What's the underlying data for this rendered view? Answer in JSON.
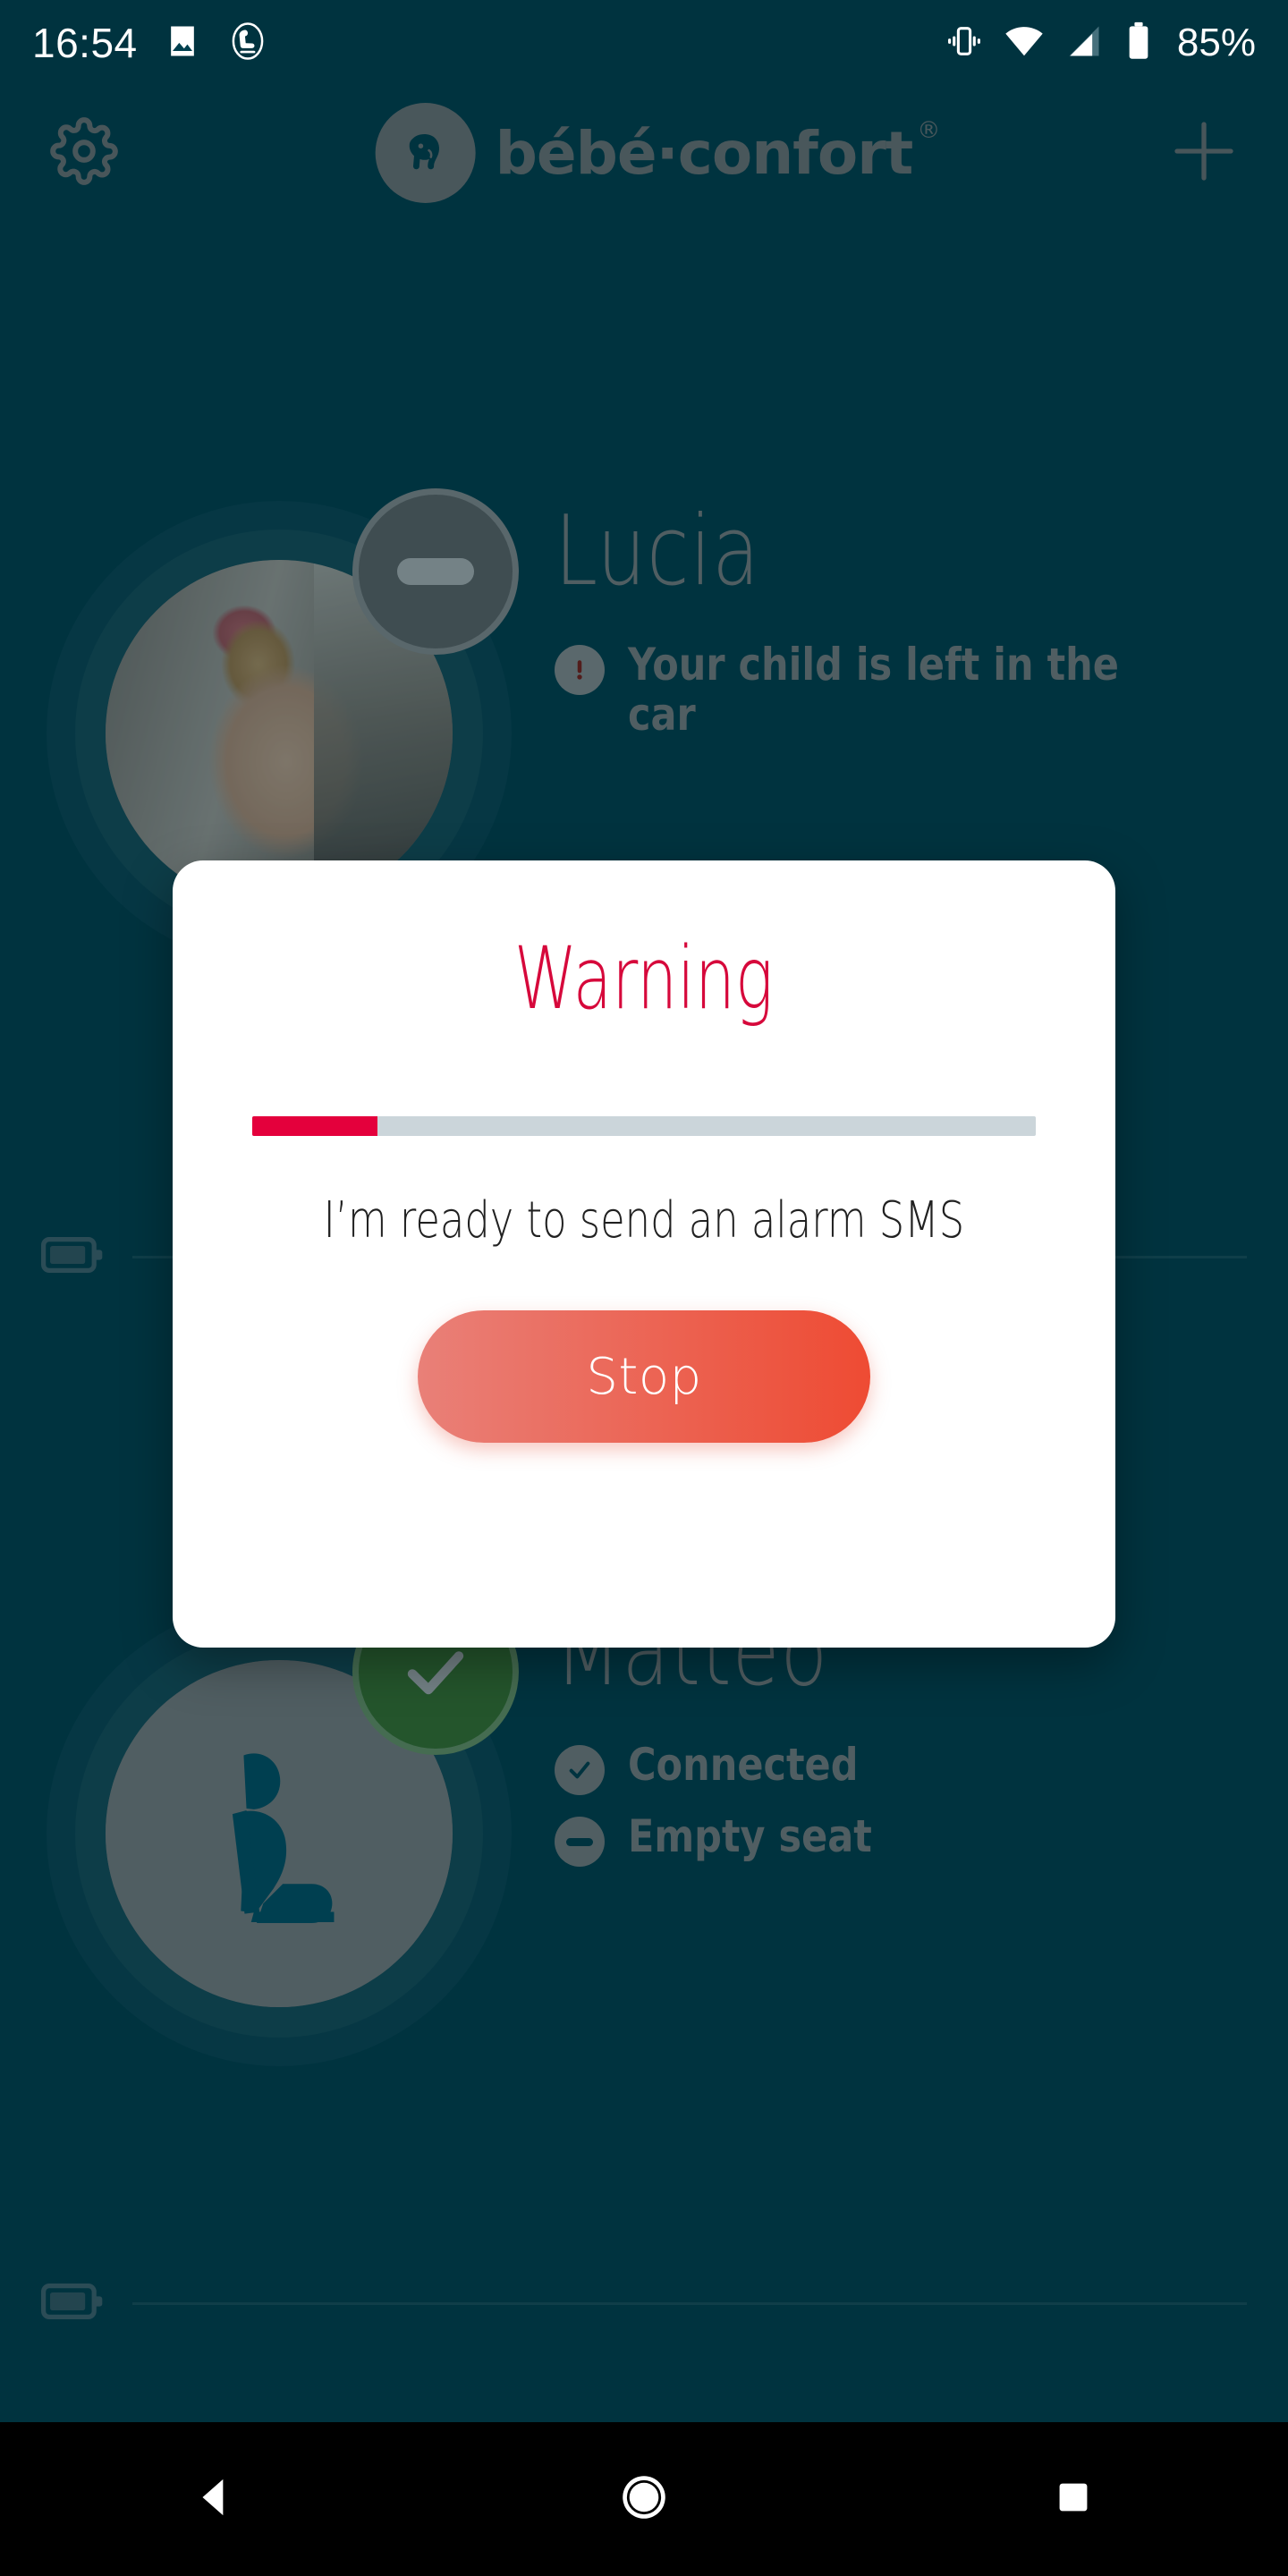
{
  "status_bar": {
    "time": "16:54",
    "icons": [
      "image-icon",
      "car-seat-icon",
      "vibrate-icon",
      "wifi-icon",
      "cellular-signal-icon",
      "battery-icon"
    ],
    "battery_percent": "85%"
  },
  "app_header": {
    "settings_icon": "gear-icon",
    "brand_name": "bébé·confort",
    "brand_registered": "®",
    "brand_mark_icon": "elephant-logo-icon",
    "add_icon": "plus-icon"
  },
  "children": [
    {
      "name": "Lucia",
      "avatar_type": "photo",
      "badge": "minus-badge",
      "badge_color": "#6D6D6D",
      "statuses": [
        {
          "icon": "alert-exclamation-icon",
          "label": "Your child is left in the car"
        }
      ]
    },
    {
      "name": "Matteo",
      "avatar_type": "car-seat-glyph",
      "badge": "check-badge",
      "badge_color": "#3E7A2E",
      "statuses": [
        {
          "icon": "check-circle-icon",
          "label": "Connected"
        },
        {
          "icon": "minus-circle-icon",
          "label": "Empty seat"
        }
      ]
    }
  ],
  "battery_rows": [
    {
      "icon": "battery-icon"
    },
    {
      "icon": "battery-icon"
    }
  ],
  "dialog": {
    "title": "Warning",
    "title_color": "#D6083B",
    "progress_percent": 16,
    "progress_fill_color": "#E4003C",
    "progress_track_color": "#CBD5DA",
    "message": "I’m ready to send an alarm SMS",
    "stop_button": "Stop",
    "stop_gradient_from": "#E98078",
    "stop_gradient_to": "#EE4B33"
  },
  "nav_bar": {
    "back": "back-triangle-icon",
    "home": "home-circle-icon",
    "recents": "recents-square-icon"
  },
  "theme": {
    "background": "#00404F",
    "muted_text": "#8A8A8A",
    "dialog_background": "#FFFFFF"
  }
}
